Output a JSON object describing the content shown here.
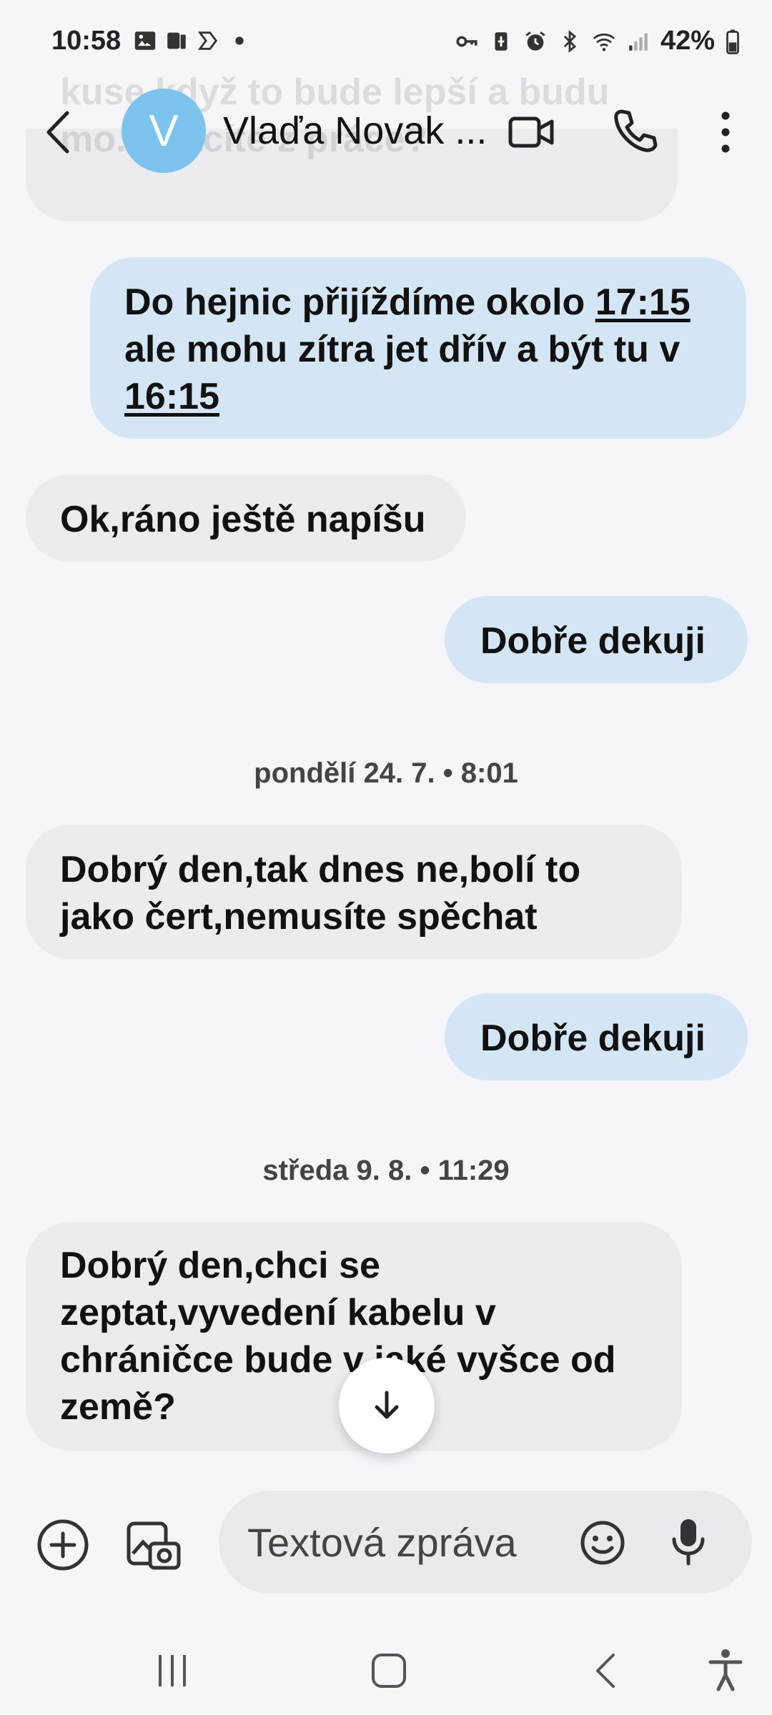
{
  "status_bar": {
    "time": "10:58",
    "battery": "42%",
    "left_icons": [
      "gallery-icon",
      "sim-card-icon",
      "app-icon",
      "dot-icon"
    ],
    "right_icons": [
      "vpn-key-icon",
      "battery-saver-icon",
      "alarm-icon",
      "bluetooth-icon",
      "wifi-icon",
      "signal-icon"
    ]
  },
  "header": {
    "avatar_letter": "V",
    "contact_name": "Vlaďa Novak ...",
    "ghost_text": "kuse když to bude lepší a budu mo...vracíte z práce?",
    "accent": "#7cc4ee"
  },
  "messages": [
    {
      "type": "sent",
      "parts": [
        "Do hejnic přijíždíme okolo ",
        "17:15",
        " ale mohu zítra jet dřív a být tu v ",
        "16:15"
      ]
    },
    {
      "type": "received",
      "text": "Ok,ráno ještě napíšu"
    },
    {
      "type": "sent",
      "text": "Dobře dekuji"
    },
    {
      "type": "date",
      "text": "pondělí 24. 7. • 8:01"
    },
    {
      "type": "received",
      "text": "Dobrý den,tak dnes ne,bolí to jako čert,nemusíte spěchat"
    },
    {
      "type": "sent",
      "text": "Dobře dekuji"
    },
    {
      "type": "date",
      "text": "středa 9. 8. • 11:29"
    },
    {
      "type": "received",
      "text": "Dobrý den,chci se zeptat,vyvedení kabelu v chráničce bude v jaké vyšce od země?"
    }
  ],
  "composer": {
    "placeholder": "Textová zpráva",
    "value": ""
  },
  "colors": {
    "sent_bubble": "#d4e6f6",
    "received_bubble": "#ececef",
    "background": "#f5f5fa"
  }
}
